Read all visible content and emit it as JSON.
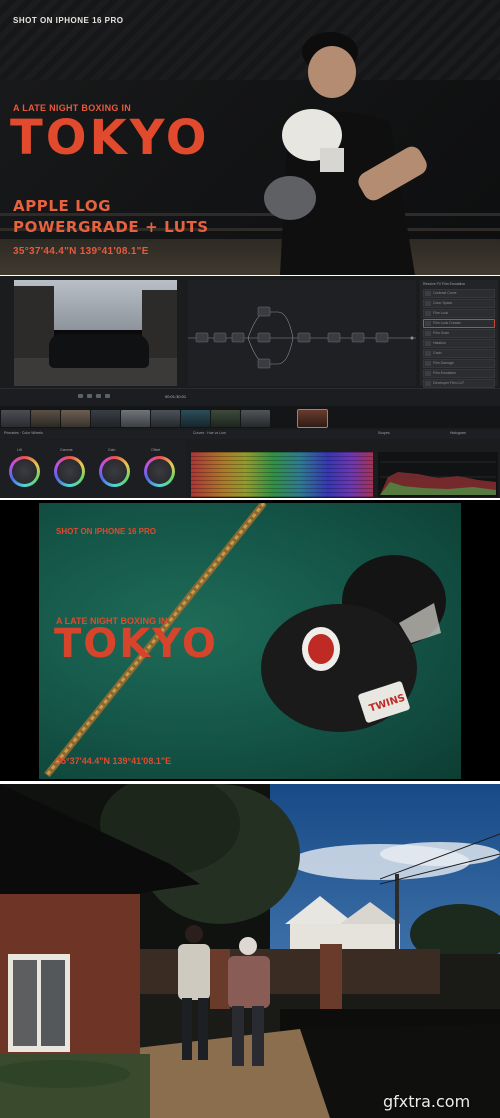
{
  "panel_top": {
    "shot_line": "SHOT ON IPHONE 16 PRO",
    "kicker": "A LATE NIGHT BOXING IN",
    "title": "TOKYO",
    "line1": "APPLE LOG",
    "line2": "POWERGRADE + LUTS",
    "coords": "35°37'44.4\"N 139°41'08.1\"E"
  },
  "grading_ui": {
    "right_panel_title": "Resolve FX Film Emulation",
    "right_panel_items": [
      "Contrast Curve",
      "Color Space",
      "Film Look",
      "Film Look Creator",
      "Film Grain",
      "Halation",
      "Grain",
      "Film Damage",
      "Film Emulation",
      "Developer Film LUT"
    ],
    "timecode": "00:01:30:01",
    "clip_labels": [
      "01",
      "02",
      "03",
      "04",
      "05",
      "06",
      "07",
      "08",
      "09",
      "10"
    ],
    "scopes_labels": [
      "Primaries · Color Wheels",
      "Curves · Hue vs Lum",
      "Scopes",
      "Histogram"
    ],
    "wheel_labels": [
      "Lift",
      "Gamma",
      "Gain",
      "Offset"
    ]
  },
  "panel_gloves": {
    "shot_line": "SHOT ON IPHONE 16 PRO",
    "kicker": "A LATE NIGHT BOXING IN",
    "title": "TOKYO",
    "coords": "35°37'44.4\"N 139°41'08.1\"E"
  },
  "watermark": "gfxtra.com",
  "colors": {
    "accent_red": "#e14a2c",
    "canvas_green": "#15584a",
    "ui_dark": "#1b1c1e"
  }
}
